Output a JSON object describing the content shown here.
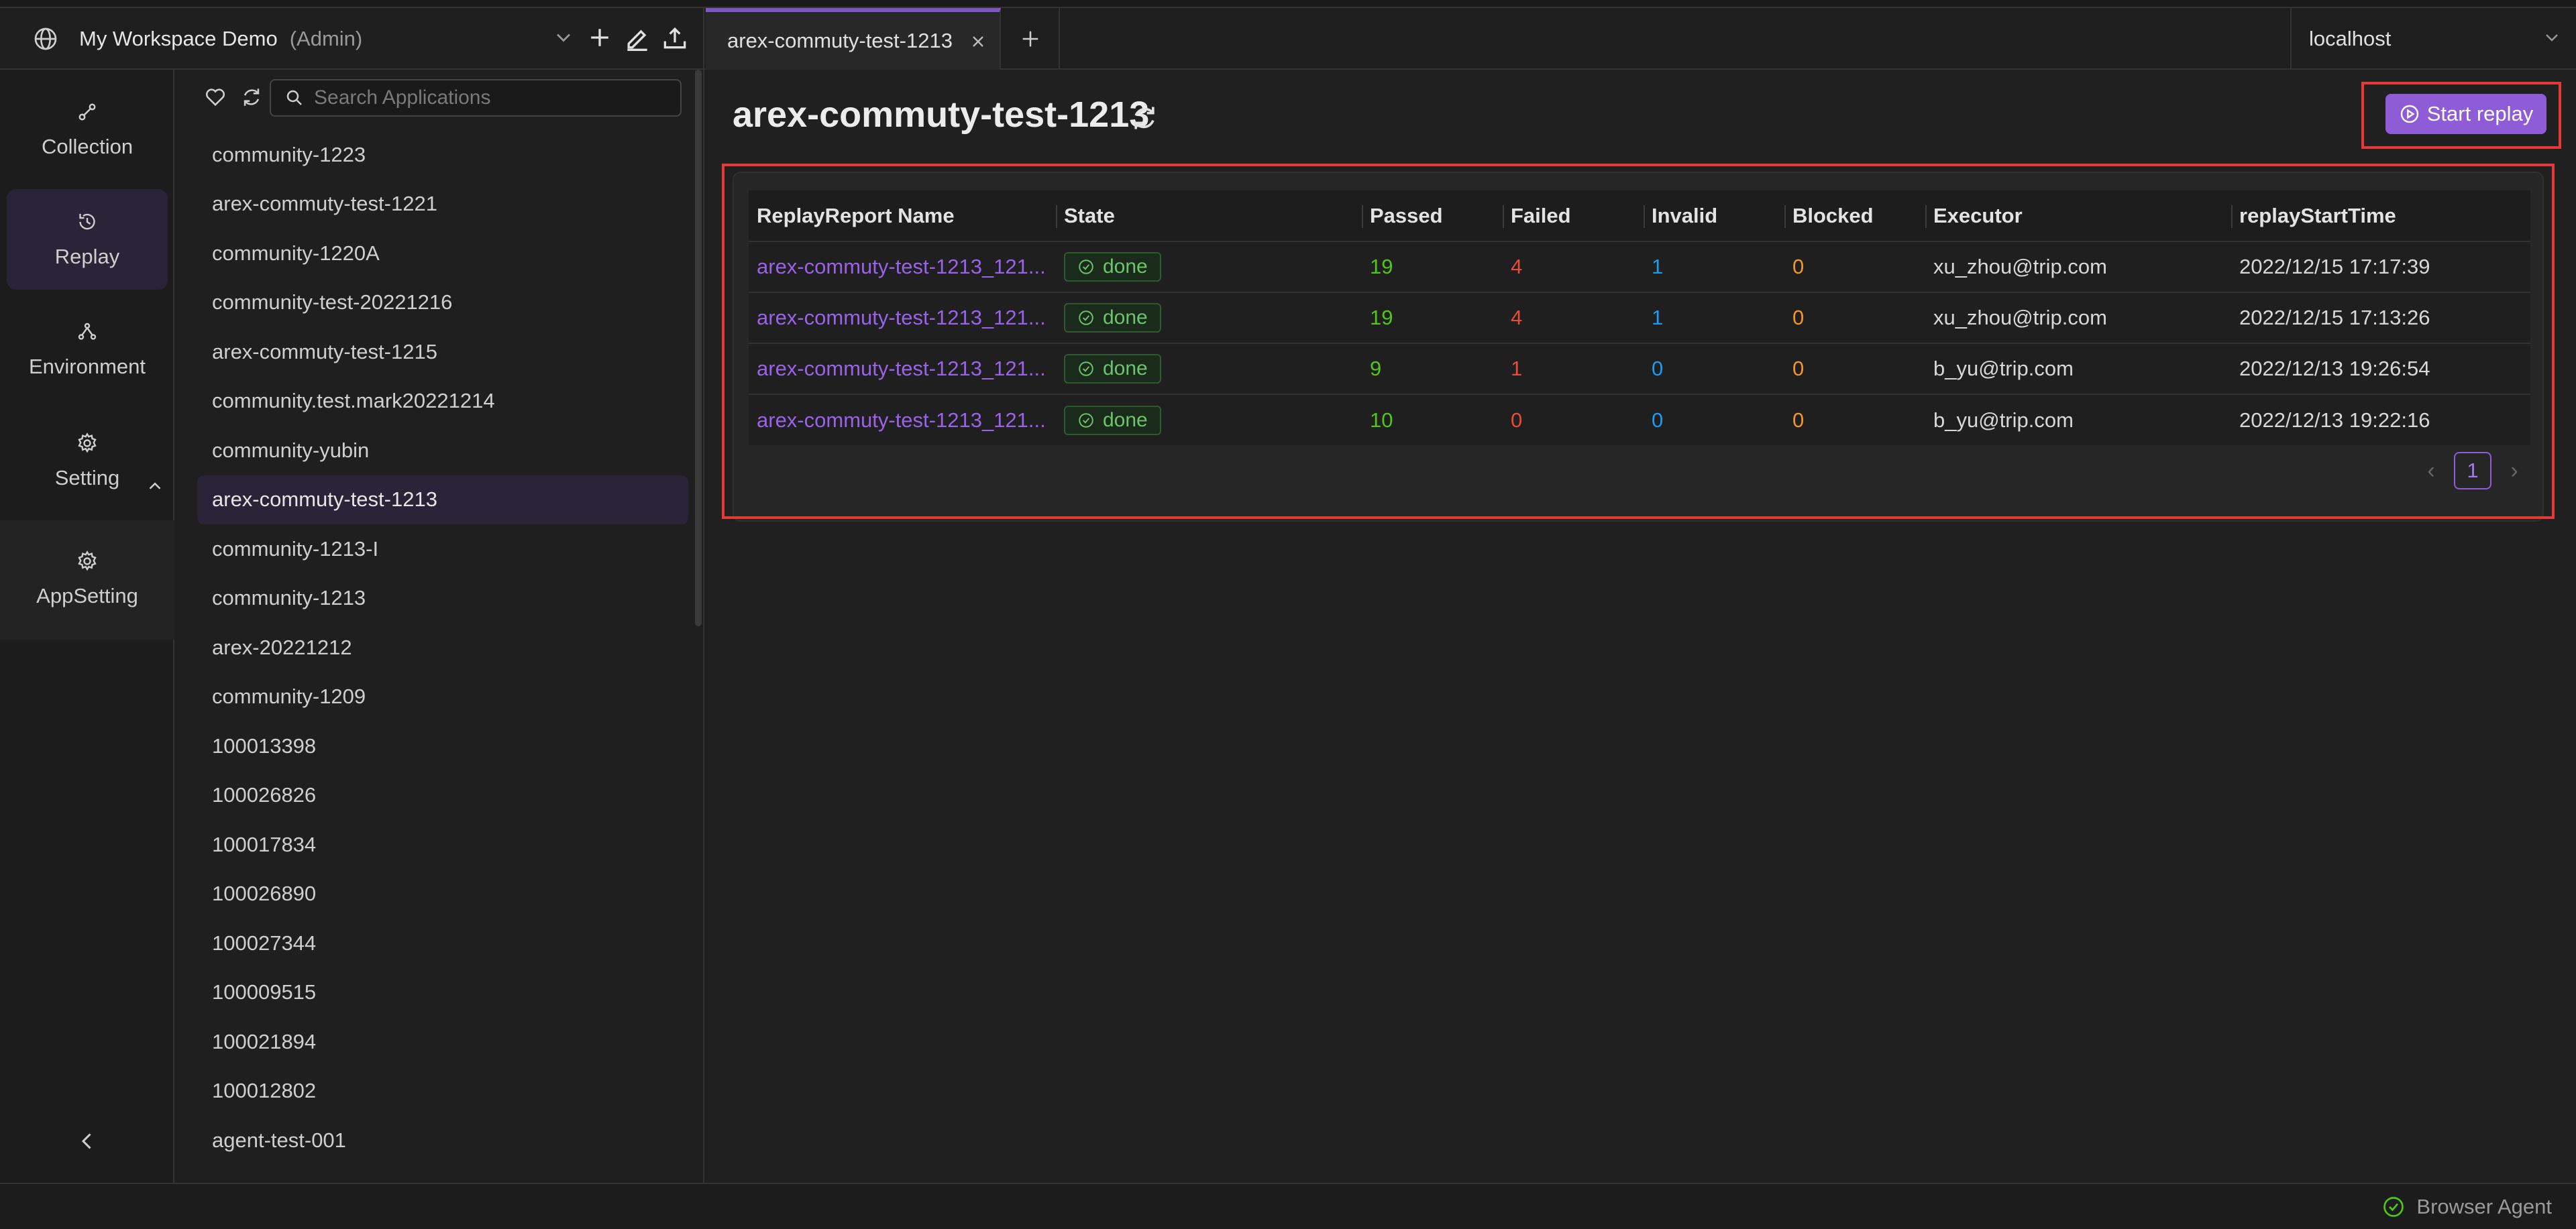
{
  "workspace": {
    "title": "My Workspace Demo",
    "role": "(Admin)"
  },
  "tabs": [
    {
      "label": "arex-commuty-test-1213"
    }
  ],
  "environment": {
    "selected": "localhost"
  },
  "nav": {
    "items": [
      {
        "label": "Collection",
        "icon": "collection-icon"
      },
      {
        "label": "Replay",
        "icon": "replay-icon"
      },
      {
        "label": "Environment",
        "icon": "environment-icon"
      },
      {
        "label": "Setting",
        "icon": "gear-icon"
      },
      {
        "label": "AppSetting",
        "icon": "gear-icon"
      }
    ]
  },
  "apps": {
    "search_placeholder": "Search Applications",
    "items": [
      "community-1223",
      "arex-commuty-test-1221",
      "community-1220A",
      "community-test-20221216",
      "arex-commuty-test-1215",
      "community.test.mark20221214",
      "community-yubin",
      "arex-commuty-test-1213",
      "community-1213-I",
      "community-1213",
      "arex-20221212",
      "community-1209",
      "100013398",
      "100026826",
      "100017834",
      "100026890",
      "100027344",
      "100009515",
      "100021894",
      "100012802",
      "agent-test-001"
    ],
    "selected_index": 7
  },
  "main": {
    "title": "arex-commuty-test-1213",
    "start_replay_label": "Start replay",
    "table": {
      "headers": [
        "ReplayReport Name",
        "State",
        "Passed",
        "Failed",
        "Invalid",
        "Blocked",
        "Executor",
        "replayStartTime"
      ],
      "rows": [
        {
          "name": "arex-commuty-test-1213_121...",
          "state": "done",
          "passed": "19",
          "failed": "4",
          "invalid": "1",
          "blocked": "0",
          "executor": "xu_zhou@trip.com",
          "time": "2022/12/15 17:17:39"
        },
        {
          "name": "arex-commuty-test-1213_121...",
          "state": "done",
          "passed": "19",
          "failed": "4",
          "invalid": "1",
          "blocked": "0",
          "executor": "xu_zhou@trip.com",
          "time": "2022/12/15 17:13:26"
        },
        {
          "name": "arex-commuty-test-1213_121...",
          "state": "done",
          "passed": "9",
          "failed": "1",
          "invalid": "0",
          "blocked": "0",
          "executor": "b_yu@trip.com",
          "time": "2022/12/13 19:26:54"
        },
        {
          "name": "arex-commuty-test-1213_121...",
          "state": "done",
          "passed": "10",
          "failed": "0",
          "invalid": "0",
          "blocked": "0",
          "executor": "b_yu@trip.com",
          "time": "2022/12/13 19:22:16"
        }
      ]
    },
    "pagination": {
      "current_page": "1"
    }
  },
  "status_bar": {
    "agent_label": "Browser Agent"
  },
  "colors": {
    "accent": "#8e5cd6",
    "highlight": "#e53935",
    "passed": "#52c41a",
    "failed": "#e84a3c",
    "invalid": "#1d9bf0",
    "blocked": "#f0962b"
  }
}
